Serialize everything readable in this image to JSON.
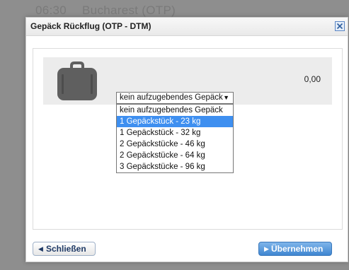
{
  "background": {
    "time": "06:30",
    "route": "Bucharest (OTP)"
  },
  "dialog": {
    "title": "Gepäck Rückflug (OTP - DTM)",
    "close_icon": "close-icon"
  },
  "luggage_row": {
    "icon": "suitcase-icon",
    "price": "0,00",
    "select_value": "kein aufzugebendes Gepäck",
    "options": [
      "kein aufzugebendes Gepäck",
      "1 Gepäckstück - 23 kg",
      "1 Gepäckstück - 32 kg",
      "2 Gepäckstücke - 46 kg",
      "2 Gepäckstücke - 64 kg",
      "3 Gepäckstücke - 96 kg"
    ],
    "highlighted_index": 1
  },
  "footer": {
    "close_label": "Schließen",
    "apply_label": "Übernehmen"
  },
  "colors": {
    "highlight": "#3e8ff0",
    "apply_button": "#3f86d1"
  }
}
